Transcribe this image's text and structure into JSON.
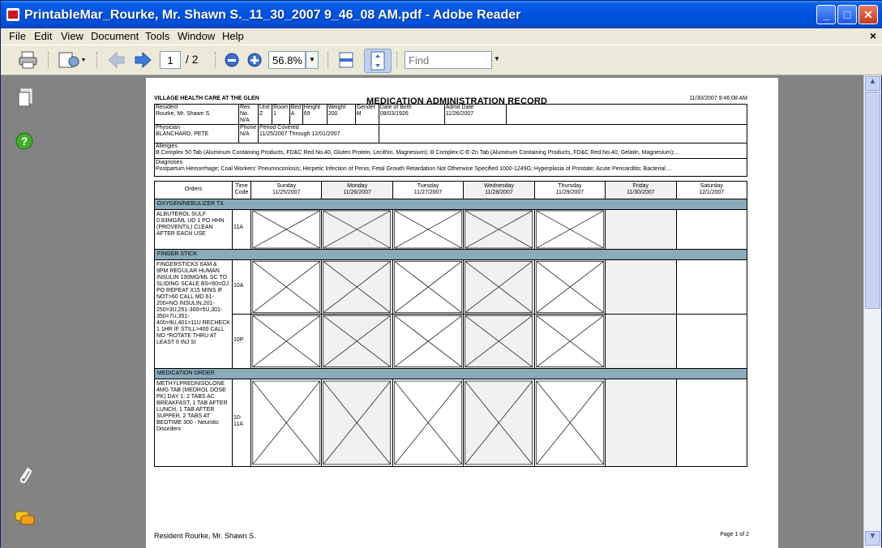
{
  "window": {
    "title": "PrintableMar_Rourke, Mr. Shawn S._11_30_2007 9_46_08 AM.pdf - Adobe Reader",
    "min": "_",
    "max": "□",
    "close": "✕"
  },
  "menu": [
    "File",
    "Edit",
    "View",
    "Document",
    "Tools",
    "Window",
    "Help"
  ],
  "menu_close": "×",
  "toolbar": {
    "page_current": "1",
    "page_total": "/ 2",
    "zoom": "56.8%",
    "find_placeholder": "Find"
  },
  "icons": {
    "print": "printer-icon",
    "acrobat": "acrobat-tool-icon",
    "back": "back-arrow-icon",
    "forward": "forward-arrow-icon",
    "zoom_out": "zoom-out-icon",
    "zoom_in": "zoom-in-icon",
    "fit_width": "fit-width-icon",
    "fit_page": "fit-page-icon",
    "pages": "pages-icon",
    "help": "help-icon",
    "attach": "paperclip-icon",
    "comments": "comments-icon"
  },
  "colors": {
    "titlebar": "#0054e3",
    "section": "#8aabb9",
    "panel": "#838383"
  },
  "form": {
    "facility": "VILLAGE HEALTH CARE AT THE GLEN",
    "title": "MEDICATION ADMINISTRATION RECORD",
    "timestamp": "11/30/2007 9:46:08 AM",
    "resident_label": "Resident",
    "resident": "Rourke, Mr. Shawn S.",
    "resno_label": "Res No.",
    "resno": "N/A",
    "unit_label": "Unit",
    "unit": "Z",
    "room_label": "Room",
    "room": "1",
    "bed_label": "Bed",
    "bed": "A",
    "height_label": "Height",
    "height": "69",
    "weight_label": "Weight",
    "weight": "200",
    "gender_label": "Gender",
    "gender": "M",
    "dob_label": "Date of Birth",
    "dob": "08/03/1926",
    "admit_label": "Admit Date",
    "admit": "11/26/2007",
    "physician_label": "Physician",
    "physician": "BLANCHARD, PETE",
    "phone_label": "Phone",
    "phone": "N/A",
    "period_label": "Period Covered",
    "period": "11/25/2007 Through 12/01/2007",
    "allergies_label": "Allergies",
    "allergies": "B Complex 50 Tab (Aluminum Containing Products, FD&C Red No.40, Gluten Protein, Lecithin, Magnesium); B Complex-C-E-Zn Tab (Aluminum Containing Products, FD&C Red No.40, Gelatin, Magnesium);...",
    "diagnoses_label": "Diagnoses",
    "diagnoses": "Postpartum Hemorrhage; Coal Workers' Pneumoconiosis; Herpetic Infection of Penis; Fetal Growth Retardation Not Otherwise Specified 1000-1249G; Hyperplasia of Prostate; Acute Pericarditis; Bacterial ...",
    "orders_header": "Orders",
    "time_code_header": "Time Code",
    "days": [
      {
        "name": "Sunday",
        "date": "11/25/2007"
      },
      {
        "name": "Monday",
        "date": "11/26/2007"
      },
      {
        "name": "Tuesday",
        "date": "11/27/2007"
      },
      {
        "name": "Wednesday",
        "date": "11/28/2007"
      },
      {
        "name": "Thursday",
        "date": "11/29/2007"
      },
      {
        "name": "Friday",
        "date": "11/30/2007"
      },
      {
        "name": "Saturday",
        "date": "12/1/2007"
      }
    ],
    "sections": [
      {
        "name": "OXYGEN/NEBULIZER TX",
        "order": "ALBUTEROL SULF 0.83MG/ML UD 1 PO HHN (PROVENTIL) CLEAN AFTER EACH USE",
        "codes": [
          "11A"
        ]
      },
      {
        "name": "FINGER STICK",
        "order": "FINGERSTICKS 6AM & 9PM REGULAR HUMAN INSULIN 100MG/ML SC TO SLIDING SCALE BS<60=OJ PO REPEAT X15 MINS IF NOT>60 CALL MD 61-200=NO INSULIN,201-250=3U,251-300=5U,301-350=7U,351-400=9U,401=11U RECHECK 1 1HR IF STILL>400 CALL MD *ROTATE THRU AT LEAST 6 INJ SI",
        "codes": [
          "10A",
          "10P"
        ]
      },
      {
        "name": "MEDICATION ORDER",
        "order": "METHYLPREDNISOLONE 4MG TAB (MEDROL DOSE PK) DAY 1: 2 TABS AC BREAKFAST, 1 TAB AFTER LUNCH, 1 TAB AFTER SUPPER, 2 TABS AT BEDTIME 300 - Neurotic Disorders",
        "codes": [
          "10-11A"
        ]
      }
    ],
    "footer_resident": "Resident  Rourke, Mr. Shawn S.",
    "footer_page": "Page 1 of 2"
  }
}
